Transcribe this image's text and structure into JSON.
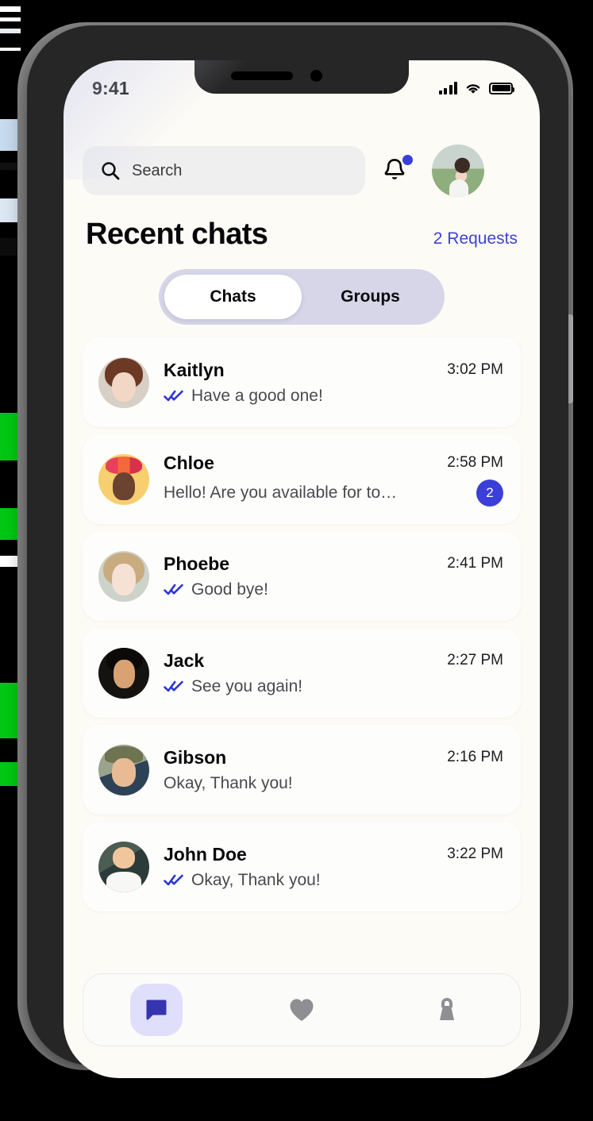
{
  "status_bar": {
    "time": "9:41",
    "signal_icon": "cellular-signal-icon",
    "wifi_icon": "wifi-icon",
    "battery_icon": "battery-icon"
  },
  "header": {
    "search_placeholder": "Search",
    "search_icon": "search-icon",
    "bell_icon": "notification-bell-icon",
    "bell_has_dot": true,
    "avatar_name": "profile-avatar"
  },
  "section": {
    "title": "Recent chats",
    "requests_label": "2 Requests"
  },
  "tabs": [
    {
      "label": "Chats",
      "active": true
    },
    {
      "label": "Groups",
      "active": false
    }
  ],
  "chats": [
    {
      "name": "Kaitlyn",
      "message": "Have a good one!",
      "time": "3:02 PM",
      "read_ticks": true,
      "unread": "",
      "avatar_class": "av-kaitlyn"
    },
    {
      "name": "Chloe",
      "message": "Hello! Are you available for toni...",
      "time": "2:58 PM",
      "read_ticks": false,
      "unread": "2",
      "avatar_class": "av-chloe"
    },
    {
      "name": "Phoebe",
      "message": "Good bye!",
      "time": "2:41 PM",
      "read_ticks": true,
      "unread": "",
      "avatar_class": "av-phoebe"
    },
    {
      "name": "Jack",
      "message": "See you again!",
      "time": "2:27 PM",
      "read_ticks": true,
      "unread": "",
      "avatar_class": "av-jack"
    },
    {
      "name": "Gibson",
      "message": "Okay, Thank you!",
      "time": "2:16 PM",
      "read_ticks": false,
      "unread": "",
      "avatar_class": "av-gibson"
    },
    {
      "name": "John Doe",
      "message": "Okay, Thank you!",
      "time": "3:22 PM",
      "read_ticks": true,
      "unread": "",
      "avatar_class": "av-john"
    }
  ],
  "bottom_nav": [
    {
      "icon": "chat-bubble-icon",
      "active": true
    },
    {
      "icon": "heart-icon",
      "active": false
    },
    {
      "icon": "lock-icon",
      "active": false
    }
  ],
  "colors": {
    "accent_indigo": "#3b3fd8",
    "link_blue": "#3b45d6",
    "tab_track": "#d6d6e8",
    "nav_chip": "#dfdffb",
    "screen_bg": "#fdfbf6",
    "card_bg": "#fdfdfc",
    "search_bg": "#efeff0",
    "inactive_icon": "#8e8e93"
  }
}
